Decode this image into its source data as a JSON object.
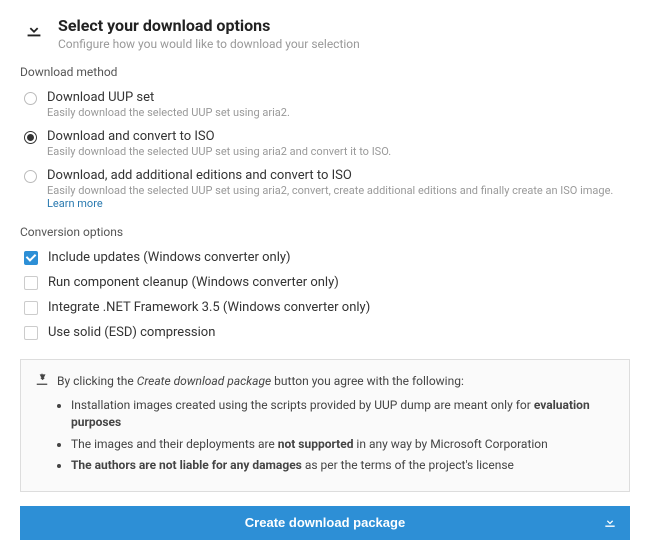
{
  "header": {
    "title": "Select your download options",
    "subtitle": "Configure how you would like to download your selection"
  },
  "download_method": {
    "label": "Download method",
    "options": [
      {
        "title": "Download UUP set",
        "desc": "Easily download the selected UUP set using aria2.",
        "selected": false
      },
      {
        "title": "Download and convert to ISO",
        "desc": "Easily download the selected UUP set using aria2 and convert it to ISO.",
        "selected": true
      },
      {
        "title": "Download, add additional editions and convert to ISO",
        "desc": "Easily download the selected UUP set using aria2, convert, create additional editions and finally create an ISO image.",
        "selected": false,
        "learn_more": "Learn more"
      }
    ]
  },
  "conversion": {
    "label": "Conversion options",
    "options": [
      {
        "title": "Include updates (Windows converter only)",
        "checked": true
      },
      {
        "title": "Run component cleanup (Windows converter only)",
        "checked": false
      },
      {
        "title": "Integrate .NET Framework 3.5 (Windows converter only)",
        "checked": false
      },
      {
        "title": "Use solid (ESD) compression",
        "checked": false
      }
    ]
  },
  "notice": {
    "intro_pre": "By clicking the ",
    "intro_em": "Create download package",
    "intro_post": " button you agree with the following:",
    "b1_pre": "Installation images created using the scripts provided by UUP dump are meant only for ",
    "b1_strong": "evaluation purposes",
    "b2_pre": "The images and their deployments are ",
    "b2_strong": "not supported",
    "b2_post": " in any way by Microsoft Corporation",
    "b3_strong": "The authors are not liable for any damages",
    "b3_post": " as per the terms of the project's license"
  },
  "button": {
    "label": "Create download package"
  }
}
